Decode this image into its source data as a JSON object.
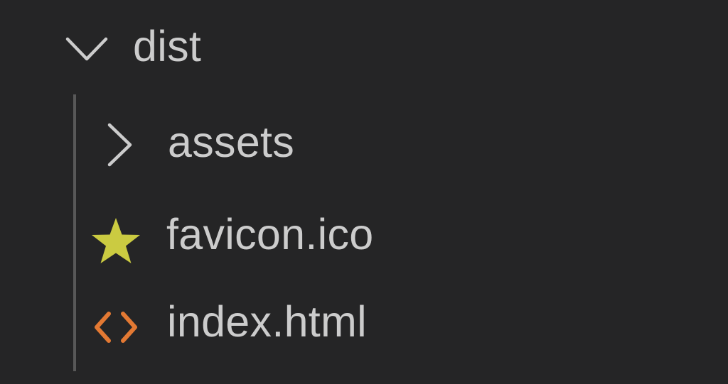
{
  "explorer": {
    "items": [
      {
        "label": "dist",
        "type": "folder",
        "expanded": true,
        "icon": "chevron-down-icon"
      },
      {
        "label": "assets",
        "type": "folder",
        "expanded": false,
        "icon": "chevron-right-icon"
      },
      {
        "label": "favicon.ico",
        "type": "file",
        "icon": "star-icon",
        "icon_color": "#cbcb41"
      },
      {
        "label": "index.html",
        "type": "file",
        "icon": "html-angle-brackets-icon",
        "icon_color": "#e37933"
      }
    ]
  },
  "colors": {
    "background": "#252526",
    "text": "#cccccc",
    "indent_guide": "#585858"
  }
}
